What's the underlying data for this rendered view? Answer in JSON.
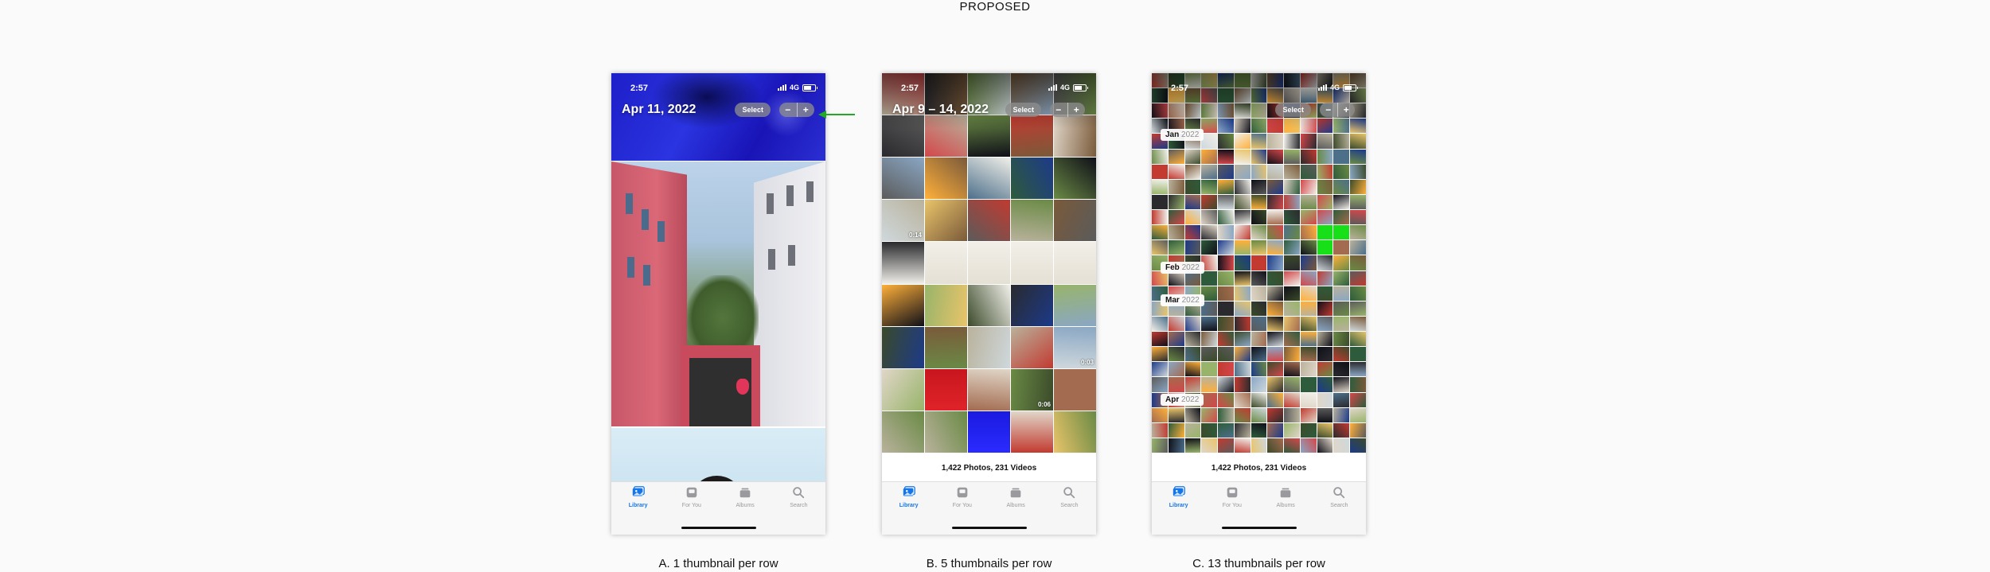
{
  "heading": "PROPOSED",
  "colors": {
    "accent": "#1476e8",
    "tab_inactive": "#9a9a9e",
    "arrow": "#22aa22"
  },
  "tabs": [
    {
      "label": "Library",
      "icon": "photo-library-icon"
    },
    {
      "label": "For You",
      "icon": "for-you-icon"
    },
    {
      "label": "Albums",
      "icon": "albums-icon"
    },
    {
      "label": "Search",
      "icon": "search-icon"
    }
  ],
  "status": {
    "time": "2:57",
    "network": "4G"
  },
  "controls": {
    "select_label": "Select",
    "zoom_out": "−",
    "zoom_in": "+"
  },
  "phones": [
    {
      "caption": "A. 1 thumbnail per row",
      "date": "Apr 11, 2022"
    },
    {
      "caption": "B. 5 thumbnails per row",
      "date": "Apr 9 – 14, 2022",
      "footer": "1,422 Photos, 231 Videos",
      "durations": [
        "0:14",
        "0:03",
        "0:06"
      ]
    },
    {
      "caption": "C. 13 thumbnails per row",
      "footer": "1,422 Photos, 231 Videos",
      "months": [
        {
          "month": "Jan",
          "year": "2022"
        },
        {
          "month": "Feb",
          "year": "2022"
        },
        {
          "month": "Mar",
          "year": "2022"
        },
        {
          "month": "Apr",
          "year": "2022"
        }
      ]
    }
  ]
}
